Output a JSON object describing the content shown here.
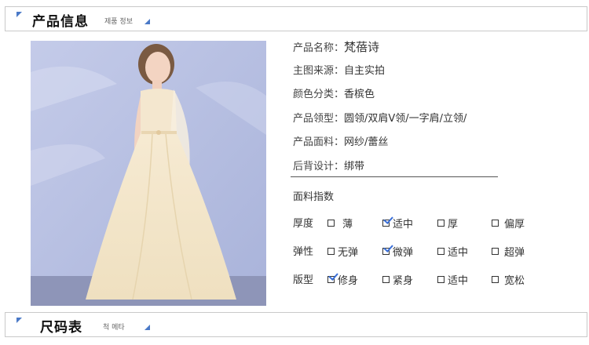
{
  "section1": {
    "title": "产品信息",
    "subtitle": "제품 정보"
  },
  "section2": {
    "title": "尺码表",
    "subtitle": "척 메타"
  },
  "photo": {
    "description_icon": "model-photo"
  },
  "info": {
    "rows": [
      {
        "label": "产品名称：",
        "value": "梵蓓诗"
      },
      {
        "label": "主图来源：",
        "value": "自主实拍"
      },
      {
        "label": "颜色分类：",
        "value": "香槟色"
      },
      {
        "label": "产品领型：",
        "value": "圆领/双肩V领/一字肩/立领/"
      },
      {
        "label": "产品面料：",
        "value": "网纱/蕾丝"
      },
      {
        "label": "后背设计：",
        "value": "绑带"
      }
    ]
  },
  "fabric_index": {
    "title": "面料指数",
    "groups": [
      {
        "label": "厚度",
        "options": [
          {
            "text": "薄",
            "checked": false
          },
          {
            "text": "适中",
            "checked": true
          },
          {
            "text": "厚",
            "checked": false
          },
          {
            "text": "偏厚",
            "checked": false
          }
        ]
      },
      {
        "label": "弹性",
        "options": [
          {
            "text": "无弹",
            "checked": false
          },
          {
            "text": "微弹",
            "checked": true
          },
          {
            "text": "适中",
            "checked": false
          },
          {
            "text": "超弹",
            "checked": false
          }
        ]
      },
      {
        "label": "版型",
        "options": [
          {
            "text": "修身",
            "checked": true
          },
          {
            "text": "紧身",
            "checked": false
          },
          {
            "text": "适中",
            "checked": false
          },
          {
            "text": "宽松",
            "checked": false
          }
        ]
      }
    ]
  },
  "colors": {
    "accent": "#4a79c7",
    "check": "#3a6fd8",
    "dress": "#f3e6c8",
    "backdrop": "#b4bde0"
  }
}
